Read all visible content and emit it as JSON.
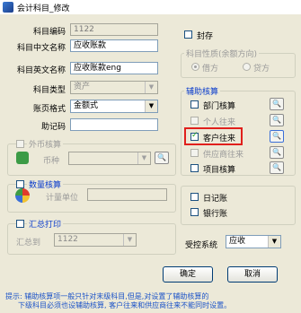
{
  "window": {
    "title": "会计科目_修改"
  },
  "code": {
    "label": "科目编码",
    "value": "1122"
  },
  "cn_name": {
    "label": "科目中文名称",
    "value": "应收账款"
  },
  "en_name": {
    "label": "科目英文名称",
    "value": "应收账款eng"
  },
  "type": {
    "label": "科目类型",
    "value": "资产"
  },
  "format": {
    "label": "账页格式",
    "value": "金额式"
  },
  "mnemonic": {
    "label": "助记码",
    "value": ""
  },
  "sealed": {
    "label": "封存"
  },
  "nature": {
    "title": "科目性质(余额方向)",
    "debit": "借方",
    "credit": "贷方"
  },
  "aux": {
    "title": "辅助核算",
    "items": [
      {
        "label": "部门核算",
        "checked": false,
        "disabled": false
      },
      {
        "label": "个人往来",
        "checked": false,
        "disabled": true
      },
      {
        "label": "客户往来",
        "checked": true,
        "disabled": false
      },
      {
        "label": "供应商往来",
        "checked": false,
        "disabled": true
      },
      {
        "label": "项目核算",
        "checked": false,
        "disabled": false
      }
    ]
  },
  "fx": {
    "title": "外币核算",
    "currency_label": "币种"
  },
  "qty": {
    "title": "数量核算",
    "unit_label": "计量单位"
  },
  "summary": {
    "title": "汇总打印",
    "to_label": "汇总到",
    "to_value": "1122"
  },
  "journal": {
    "label": "日记账"
  },
  "bankbook": {
    "label": "银行账"
  },
  "controlled": {
    "label": "受控系统",
    "value": "应收"
  },
  "buttons": {
    "ok": "确定",
    "cancel": "取消"
  },
  "hint": {
    "line1": "提示: 辅助核算项一般只针对末级科目,但是,对设置了辅助核算的",
    "line2": "下级科目必须也设辅助核算, 客户往来和供应商往来不能同时设置。"
  },
  "colors": {
    "accent": "#0a3ccc",
    "highlight": "#e0201c",
    "window_bg": "#ece9d8"
  }
}
